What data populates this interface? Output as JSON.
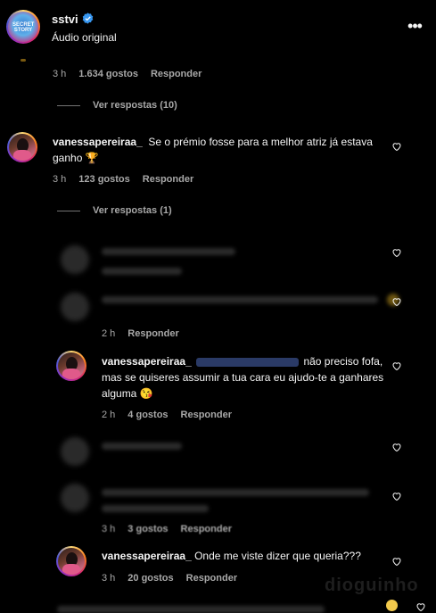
{
  "header": {
    "account": "sstvi",
    "subtitle": "Áudio original",
    "avatar_label": "SECRET STORY",
    "more_label": "•••"
  },
  "comments": [
    {
      "time": "3 h",
      "likes": "1.634 gostos",
      "reply": "Responder"
    },
    {
      "user": "vanessapereiraa_",
      "text": "Se o prémio fosse para a melhor atriz já estava ganho 🏆",
      "time": "3 h",
      "likes": "123 gostos",
      "reply": "Responder"
    },
    {
      "time": "2 h",
      "reply": "Responder"
    },
    {
      "user": "vanessapereiraa_",
      "text": "não preciso fofa, mas se quiseres assumir a tua cara eu ajudo-te a ganhares alguma 😘",
      "time": "2 h",
      "likes": "4 gostos",
      "reply": "Responder"
    },
    {
      "time": "3 h",
      "likes": "3 gostos",
      "reply": "Responder"
    },
    {
      "user": "vanessapereiraa_",
      "text": "Onde me viste dizer que queria???",
      "time": "3 h",
      "likes": "20 gostos",
      "reply": "Responder"
    }
  ],
  "view_replies": [
    "Ver respostas (10)",
    "Ver respostas (1)"
  ],
  "watermark": "dioguinho",
  "colors": {
    "background": "#000000",
    "text": "#f5f5f5",
    "muted": "#a8a8a8",
    "verified": "#3897f0"
  },
  "icons": {
    "verified": "verified-badge-icon",
    "more": "more-options-icon",
    "like": "heart-outline-icon"
  }
}
